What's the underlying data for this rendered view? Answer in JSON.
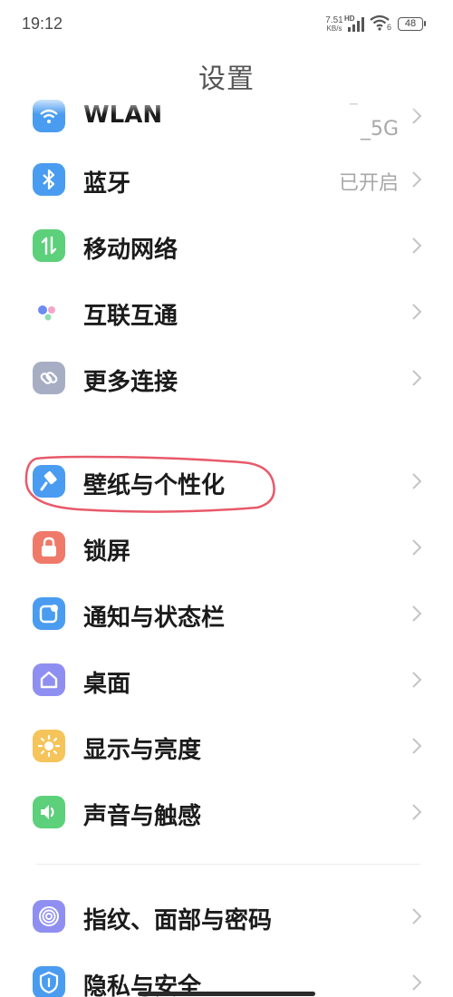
{
  "status_bar": {
    "time": "19:12",
    "net_speed_value": "7.51",
    "net_speed_unit": "KB/s",
    "network_type": "HD",
    "wifi_badge": "6",
    "battery_level": "48"
  },
  "header": {
    "title": "设置"
  },
  "settings": {
    "wlan": {
      "label": "WLAN",
      "value_line1": "–",
      "value_line2": "_5G",
      "icon": "wifi-icon",
      "color": "#4A9CF0"
    },
    "bluetooth": {
      "label": "蓝牙",
      "value": "已开启",
      "icon": "bluetooth-icon",
      "color": "#4A9CF0"
    },
    "mobile_network": {
      "label": "移动网络",
      "icon": "mobile-data-icon",
      "color": "#5CD07A"
    },
    "interconnect": {
      "label": "互联互通",
      "icon": "interconnect-dots-icon"
    },
    "more_connections": {
      "label": "更多连接",
      "icon": "link-icon",
      "color": "#A7AEC4"
    },
    "wallpaper": {
      "label": "壁纸与个性化",
      "icon": "paint-brush-icon",
      "color": "#4A9CF0"
    },
    "lock_screen": {
      "label": "锁屏",
      "icon": "lock-icon",
      "color": "#F07A6A"
    },
    "notifications": {
      "label": "通知与状态栏",
      "icon": "notification-icon",
      "color": "#4A9CF0"
    },
    "desktop": {
      "label": "桌面",
      "icon": "home-icon",
      "color": "#8F8FF2"
    },
    "display": {
      "label": "显示与亮度",
      "icon": "sun-icon",
      "color": "#F5C45A"
    },
    "sound": {
      "label": "声音与触感",
      "icon": "speaker-icon",
      "color": "#5CD07A"
    },
    "fingerprint": {
      "label": "指纹、面部与密码",
      "icon": "fingerprint-icon",
      "color": "#8F8FF2"
    },
    "privacy": {
      "label": "隐私与安全",
      "icon": "shield-icon",
      "color": "#4A9CF0"
    }
  },
  "annotation": {
    "highlight_color": "#E85A6A"
  }
}
